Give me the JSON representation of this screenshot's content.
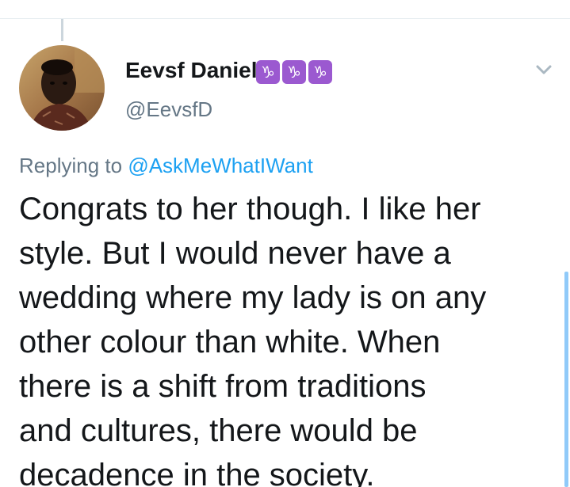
{
  "tweet": {
    "display_name": "Eevsf Daniel",
    "name_emojis": [
      "♑",
      "♑",
      "♑"
    ],
    "handle": "@EevsfD",
    "replying_label": "Replying to ",
    "replying_to": "@AskMeWhatIWant",
    "text": "Congrats to her though. I like her\nstyle. But I would never have a\nwedding where my lady is on any\nother colour than white. When\nthere is a shift from traditions\nand cultures, there would be\ndecadence in the society."
  },
  "icons": {
    "avatar": "profile-photo",
    "caret": "chevron-down-icon",
    "emoji": "capricorn-emoji"
  },
  "colors": {
    "link": "#1da1f2",
    "secondary_text": "#657786",
    "primary_text": "#14171a",
    "emoji_bg": "#9b59d0",
    "scrollbar": "#90caf9"
  }
}
